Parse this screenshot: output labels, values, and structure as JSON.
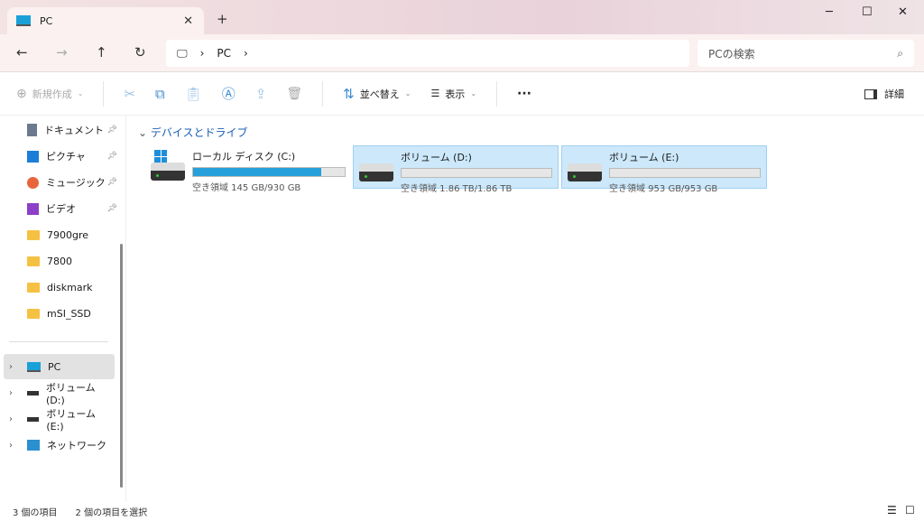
{
  "window": {
    "tab_title": "PC",
    "close": "✕",
    "new_tab": "+"
  },
  "nav": {
    "breadcrumb": [
      "PC"
    ],
    "search_placeholder": "PCの検索"
  },
  "toolbar": {
    "new": "新規作成",
    "sort": "並べ替え",
    "view": "表示",
    "more": "···",
    "details": "詳細"
  },
  "sidebar": {
    "quick": [
      {
        "label": "ドキュメント",
        "pinned": true
      },
      {
        "label": "ピクチャ",
        "pinned": true
      },
      {
        "label": "ミュージック",
        "pinned": true
      },
      {
        "label": "ビデオ",
        "pinned": true
      },
      {
        "label": "7900gre"
      },
      {
        "label": "7800"
      },
      {
        "label": "diskmark"
      },
      {
        "label": "mSI_SSD"
      }
    ],
    "tree": [
      {
        "label": "PC"
      },
      {
        "label": "ボリューム (D:)"
      },
      {
        "label": "ボリューム (E:)"
      },
      {
        "label": "ネットワーク"
      }
    ]
  },
  "main": {
    "group": "デバイスとドライブ",
    "drives": [
      {
        "name": "ローカル ディスク (C:)",
        "free": "空き領域 145 GB/930 GB",
        "used_fraction": 0.844,
        "selected": false
      },
      {
        "name": "ボリューム (D:)",
        "free": "空き領域 1.86 TB/1.86 TB",
        "used_fraction": 0.0,
        "selected": true
      },
      {
        "name": "ボリューム (E:)",
        "free": "空き領域 953 GB/953 GB",
        "used_fraction": 0.0,
        "selected": true
      }
    ]
  },
  "status": {
    "count": "3 個の項目",
    "selected": "2 個の項目を選択"
  }
}
